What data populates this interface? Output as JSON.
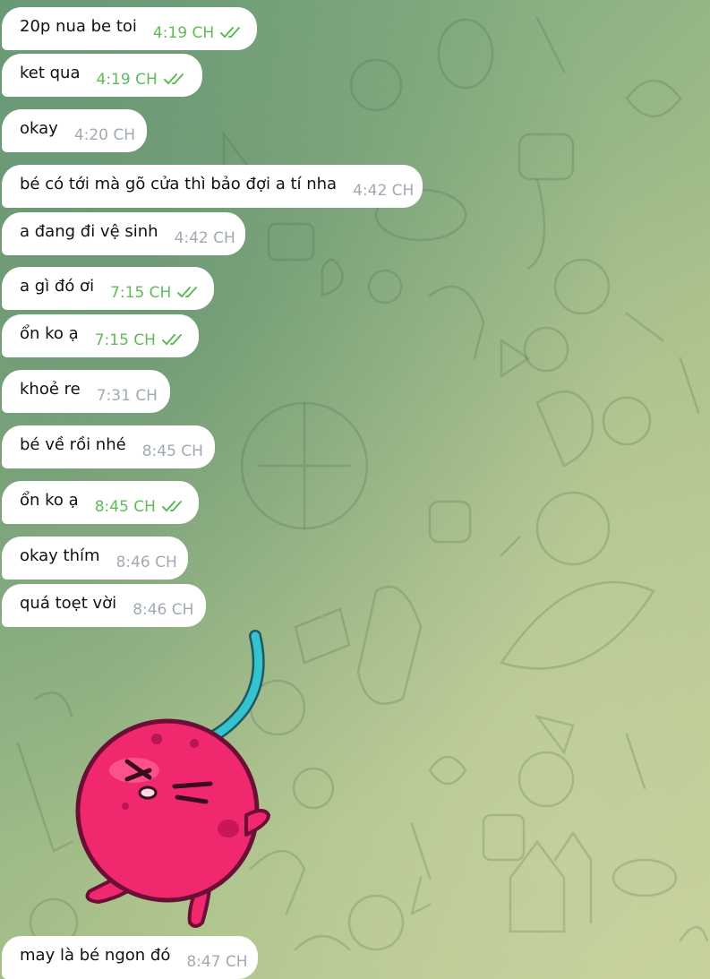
{
  "messages": [
    {
      "text": "20p nua be toi",
      "time": "4:19 CH",
      "read": true
    },
    {
      "text": "ket qua",
      "time": "4:19 CH",
      "read": true
    },
    {
      "text": "okay",
      "time": "4:20 CH",
      "read": false
    },
    {
      "text": "bé có tới mà gõ cửa thì bảo đợi a tí nha",
      "time": "4:42 CH",
      "read": false
    },
    {
      "text": "a đang đi vệ sinh",
      "time": "4:42 CH",
      "read": false
    },
    {
      "text": "a gì đó ơi",
      "time": "7:15 CH",
      "read": true
    },
    {
      "text": "ổn ko ạ",
      "time": "7:15 CH",
      "read": true
    },
    {
      "text": "khoẻ re",
      "time": "7:31 CH",
      "read": false
    },
    {
      "text": "bé về rồi nhé",
      "time": "8:45 CH",
      "read": false
    },
    {
      "text": "ổn ko ạ",
      "time": "8:45 CH",
      "read": true
    },
    {
      "text": "okay thím",
      "time": "8:46 CH",
      "read": false
    },
    {
      "text": "quá toẹt vời",
      "time": "8:46 CH",
      "read": false
    },
    {
      "text": "may là bé ngon đó",
      "time": "8:47 CH",
      "read": false
    }
  ],
  "sticker": {
    "name": "cherry-sticker",
    "main_color": "#f0286e",
    "stem_color": "#35c3cf"
  },
  "colors": {
    "time_read": "#5fba5a",
    "time_default": "#a1aab3",
    "bubble": "#ffffff"
  }
}
